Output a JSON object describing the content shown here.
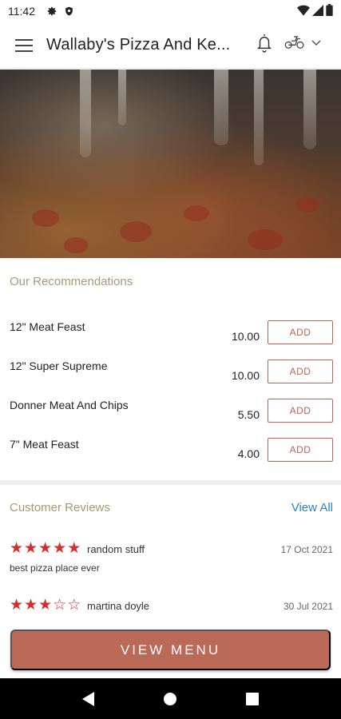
{
  "status_bar": {
    "time": "11:42"
  },
  "app_bar": {
    "title": "Wallaby's Pizza And Ke..."
  },
  "recommendations": {
    "heading": "Our Recommendations",
    "items": [
      {
        "name": "12\" Meat Feast",
        "price": "10.00",
        "button": "ADD"
      },
      {
        "name": "12\" Super Supreme",
        "price": "10.00",
        "button": "ADD"
      },
      {
        "name": "Donner Meat And Chips",
        "price": "5.50",
        "button": "ADD"
      },
      {
        "name": "7\" Meat Feast",
        "price": "4.00",
        "button": "ADD"
      }
    ]
  },
  "reviews": {
    "heading": "Customer Reviews",
    "view_all": "View All",
    "items": [
      {
        "rating": 5,
        "name": "random stuff",
        "date": "17 Oct 2021",
        "text": "best pizza place ever"
      },
      {
        "rating": 3,
        "name": "martina doyle",
        "date": "30 Jul 2021",
        "text": ""
      }
    ]
  },
  "view_menu": {
    "label": "VIEW MENU"
  },
  "colors": {
    "accent": "#bb6a58",
    "section_heading": "#a89a74",
    "link": "#2b83c1",
    "star": "#d62d2d"
  }
}
